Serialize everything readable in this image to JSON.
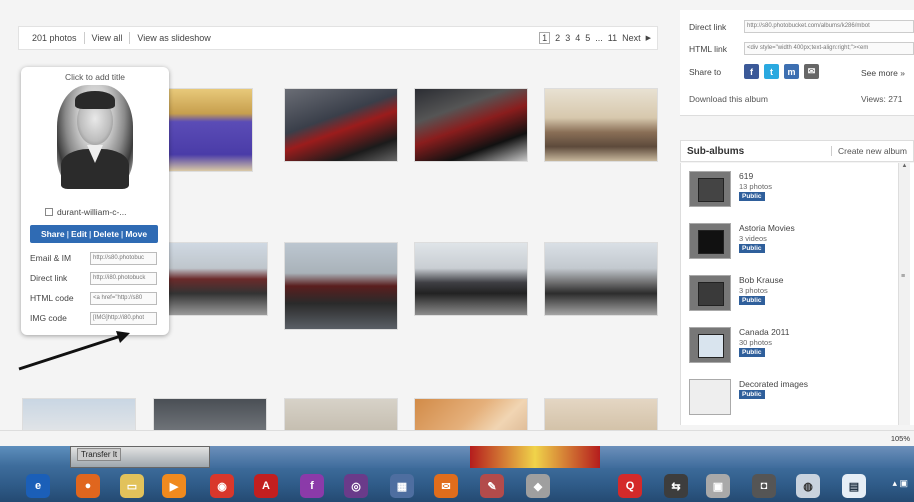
{
  "topbar": {
    "photos_count": "201 photos",
    "view_all": "View all",
    "view_slideshow": "View as slideshow",
    "pages": [
      "1",
      "2",
      "3",
      "4",
      "5",
      "...",
      "11"
    ],
    "next_label": "Next"
  },
  "popup": {
    "title": "Click to add title",
    "filename": "durant-william-c-...",
    "actions": [
      "Share",
      "Edit",
      "Delete",
      "Move"
    ],
    "fields": [
      {
        "label": "Email & IM",
        "value": "http://s80.photobuc"
      },
      {
        "label": "Direct link",
        "value": "http://i80.photobuck"
      },
      {
        "label": "HTML code",
        "value": "<a href=\"http://s80"
      },
      {
        "label": "IMG code",
        "value": "[IMG]http://i80.phot"
      }
    ]
  },
  "share": {
    "direct_link_label": "Direct link",
    "direct_link_value": "http://s80.photobucket.com/albums/k286/mbot",
    "html_link_label": "HTML link",
    "html_link_value": "<div style=\"width 400px;text-align:right;\"><em",
    "share_to_label": "Share to",
    "see_more": "See more »",
    "download": "Download this album",
    "views": "Views: 271"
  },
  "subalbums": {
    "header": "Sub-albums",
    "create": "Create new album",
    "items": [
      {
        "name": "619",
        "count": "13 photos",
        "badge": "Public"
      },
      {
        "name": "Astoria Movies",
        "count": "3 videos",
        "badge": "Public"
      },
      {
        "name": "Bob Krause",
        "count": "3 photos",
        "badge": "Public"
      },
      {
        "name": "Canada 2011",
        "count": "30 photos",
        "badge": "Public"
      },
      {
        "name": "Decorated images",
        "count": "",
        "badge": "Public"
      }
    ]
  },
  "status": {
    "zoom": "105%"
  },
  "taskbar": {
    "window_label": "Transfer It"
  },
  "colors": {
    "accent": "#2f6bb4",
    "badge": "#2f5f9b",
    "taskbar": "#3e6d9c"
  },
  "icons": [
    "ie-icon",
    "firefox-icon",
    "folder-icon",
    "media-player-icon",
    "chrome-icon",
    "acrobat-icon",
    "feedback-icon",
    "lock-icon",
    "app-icon",
    "mail-icon",
    "tool-icon",
    "q-icon",
    "arrows-icon",
    "image-icon",
    "camera-icon",
    "dvd-icon",
    "notepad-icon"
  ]
}
